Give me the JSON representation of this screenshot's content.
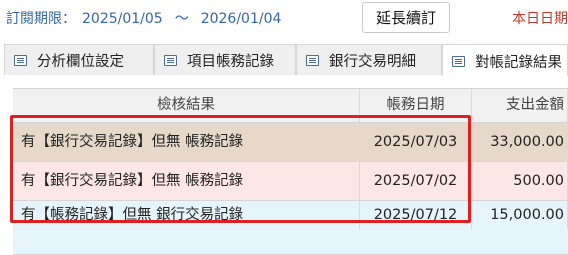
{
  "subscription": {
    "period_label": "訂閱期限：",
    "start_date": "2025/01/05",
    "separator": "～",
    "end_date": "2026/01/04",
    "extend_button": "延長續訂",
    "today_label": "本日日期"
  },
  "tabs": [
    {
      "label": "分析欄位設定",
      "icon": "table-icon",
      "active": false
    },
    {
      "label": "項目帳務記錄",
      "icon": "table-icon",
      "active": false
    },
    {
      "label": "銀行交易明細",
      "icon": "table-icon",
      "active": false
    },
    {
      "label": "對帳記錄結果",
      "icon": "table-icon",
      "active": true
    }
  ],
  "grid": {
    "columns": [
      "檢核結果",
      "帳務日期",
      "支出金額"
    ],
    "rows": [
      {
        "result": "有【銀行交易記錄】但無 帳務記錄",
        "date": "2025/07/03",
        "amount": "33,000.00",
        "row_color": "#e6d9c9"
      },
      {
        "result": "有【銀行交易記錄】但無 帳務記錄",
        "date": "2025/07/02",
        "amount": "500.00",
        "row_color": "#fde6e6"
      },
      {
        "result": "有【帳務記錄】但無 銀行交易記錄",
        "date": "2025/07/12",
        "amount": "15,000.00",
        "row_color": "#e6f5fb"
      }
    ]
  },
  "colors": {
    "period_text": "#3566a8",
    "today_text": "#c0392b",
    "highlight_border": "#e02020"
  }
}
